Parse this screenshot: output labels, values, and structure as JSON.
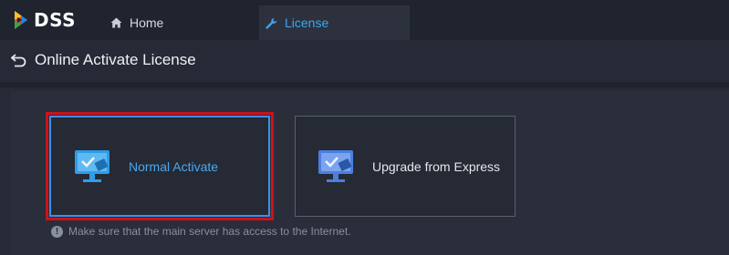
{
  "app": {
    "logo_text": "DSS"
  },
  "nav": {
    "tabs": [
      {
        "label": "Home",
        "icon": "home-icon",
        "active": false
      },
      {
        "label": "License",
        "icon": "wrench-icon",
        "active": true
      }
    ]
  },
  "header": {
    "title": "Online Activate License",
    "back_icon": "back-icon"
  },
  "options": [
    {
      "label": "Normal Activate",
      "icon": "monitor-pro-icon",
      "selected": true
    },
    {
      "label": "Upgrade from Express",
      "icon": "monitor-exp-icon",
      "selected": false
    }
  ],
  "notice": {
    "text": "Make sure that the main server has access to the Internet.",
    "icon": "warning-icon"
  },
  "colors": {
    "accent": "#3da7ef",
    "highlight": "#c9131d",
    "background": "#262a36"
  }
}
